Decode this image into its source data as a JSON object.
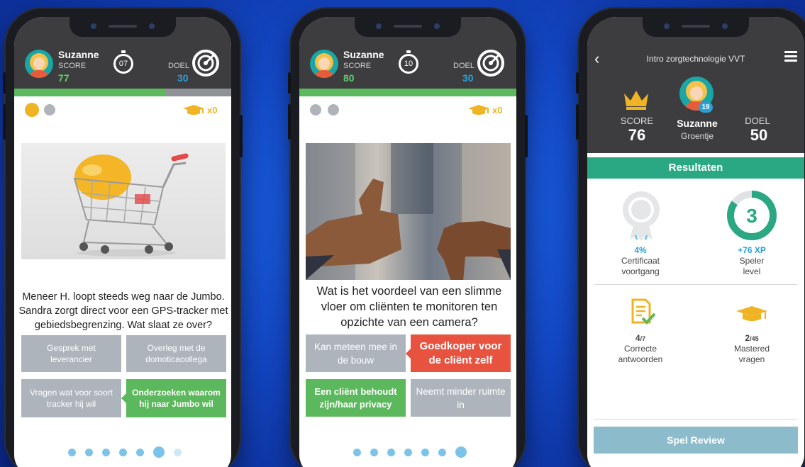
{
  "phone1": {
    "user": "Suzanne",
    "score_label": "SCORE",
    "score": "77",
    "timer": "07",
    "goal_label": "DOEL",
    "goal": "30",
    "hats": "x0",
    "question": "Meneer H. loopt steeds weg naar de Jumbo. Sandra zorgt direct voor een GPS-tracker met gebiedsbegrenzing. Wat slaat ze over?",
    "answers": [
      "Gesprek met leverancier",
      "Overleg met de domoticacollega",
      "Vragen wat voor soort tracker hij wil",
      "Onderzoeken waarom hij naar Jumbo wil"
    ],
    "progress_fraction": 0.7
  },
  "phone2": {
    "user": "Suzanne",
    "score_label": "SCORE",
    "score": "80",
    "timer": "10",
    "goal_label": "DOEL",
    "goal": "30",
    "hats": "x0",
    "question": "Wat is het voordeel van een slimme vloer om cliënten te monitoren ten opzichte van een camera?",
    "answers": [
      "Kan meteen mee in de bouw",
      "Goedkoper voor de cliënt zelf",
      "Een cliënt behoudt zijn/haar privacy",
      "Neemt minder ruimte in"
    ],
    "progress_fraction": 1.0
  },
  "phone3": {
    "title": "Intro zorgtechnologie VVT",
    "score_label": "SCORE",
    "score": "76",
    "user": "Suzanne",
    "user_rank": "Groentje",
    "user_level_badge": "19",
    "goal_label": "DOEL",
    "goal": "50",
    "results_label": "Resultaten",
    "certificate_value": "4%",
    "certificate_label_1": "Certificaat",
    "certificate_label_2": "voortgang",
    "level_value": "3",
    "xp_value": "+76 XP",
    "level_label_1": "Speler",
    "level_label_2": "level",
    "correct_value_main": "4",
    "correct_value_total": "/7",
    "correct_label_1": "Correcte",
    "correct_label_2": "antwoorden",
    "mastered_value_main": "2",
    "mastered_value_total": "/45",
    "mastered_label_1": "Mastered",
    "mastered_label_2": "vragen",
    "review_button": "Spel Review"
  },
  "colors": {
    "header_bg": "#3d3d3f",
    "green": "#5cb85c",
    "teal": "#2aa884",
    "red": "#e8533f",
    "blue": "#2aa0d6",
    "gold": "#f0b323"
  },
  "icons": [
    "stopwatch-icon",
    "target-icon",
    "graduation-cap-icon",
    "crown-icon",
    "award-ribbon-icon",
    "checklist-icon",
    "chevron-left-icon",
    "hamburger-menu-icon"
  ]
}
